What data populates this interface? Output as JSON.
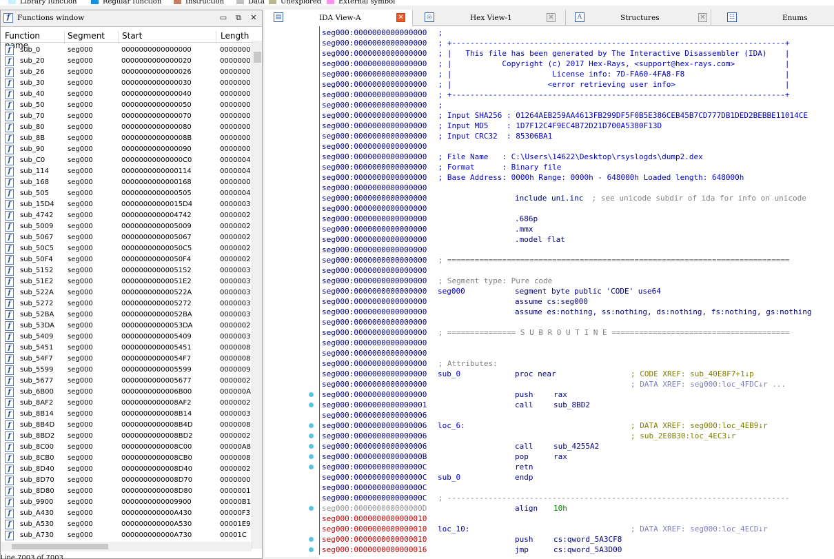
{
  "legend": [
    {
      "label": "Library function",
      "color": "#c8f0ff"
    },
    {
      "label": "Regular function",
      "color": "#1a8fe0"
    },
    {
      "label": "Instruction",
      "color": "#c08060"
    },
    {
      "label": "Data",
      "color": "#c0c0c0"
    },
    {
      "label": "Unexplored",
      "color": "#b8b890"
    },
    {
      "label": "External symbol",
      "color": "#ff90f0"
    }
  ],
  "functions_window": {
    "title": "Functions window",
    "columns": [
      "Function name",
      "Segment",
      "Start",
      "Length"
    ],
    "status": "Line 7003 of 7003",
    "rows": [
      [
        "sub_0",
        "seg000",
        "0000000000000000",
        "0000000"
      ],
      [
        "sub_20",
        "seg000",
        "0000000000000020",
        "0000000"
      ],
      [
        "sub_26",
        "seg000",
        "0000000000000026",
        "0000000"
      ],
      [
        "sub_30",
        "seg000",
        "0000000000000030",
        "0000000"
      ],
      [
        "sub_40",
        "seg000",
        "0000000000000040",
        "0000000"
      ],
      [
        "sub_50",
        "seg000",
        "0000000000000050",
        "0000000"
      ],
      [
        "sub_70",
        "seg000",
        "0000000000000070",
        "0000000"
      ],
      [
        "sub_80",
        "seg000",
        "0000000000000080",
        "0000000"
      ],
      [
        "sub_8B",
        "seg000",
        "000000000000008B",
        "0000000"
      ],
      [
        "sub_90",
        "seg000",
        "0000000000000090",
        "0000000"
      ],
      [
        "sub_C0",
        "seg000",
        "00000000000000C0",
        "0000004"
      ],
      [
        "sub_114",
        "seg000",
        "0000000000000114",
        "0000004"
      ],
      [
        "sub_168",
        "seg000",
        "0000000000000168",
        "0000000"
      ],
      [
        "sub_505",
        "seg000",
        "0000000000000505",
        "0000004"
      ],
      [
        "sub_15D4",
        "seg000",
        "00000000000015D4",
        "0000003"
      ],
      [
        "sub_4742",
        "seg000",
        "0000000000004742",
        "0000002"
      ],
      [
        "sub_5009",
        "seg000",
        "0000000000005009",
        "0000002"
      ],
      [
        "sub_5067",
        "seg000",
        "0000000000005067",
        "0000002"
      ],
      [
        "sub_50C5",
        "seg000",
        "00000000000050C5",
        "0000002"
      ],
      [
        "sub_50F4",
        "seg000",
        "00000000000050F4",
        "0000002"
      ],
      [
        "sub_5152",
        "seg000",
        "0000000000005152",
        "0000003"
      ],
      [
        "sub_51E2",
        "seg000",
        "00000000000051E2",
        "0000003"
      ],
      [
        "sub_522A",
        "seg000",
        "000000000000522A",
        "0000003"
      ],
      [
        "sub_5272",
        "seg000",
        "0000000000005272",
        "0000003"
      ],
      [
        "sub_52BA",
        "seg000",
        "00000000000052BA",
        "0000003"
      ],
      [
        "sub_53DA",
        "seg000",
        "00000000000053DA",
        "0000002"
      ],
      [
        "sub_5409",
        "seg000",
        "0000000000005409",
        "0000003"
      ],
      [
        "sub_5451",
        "seg000",
        "0000000000005451",
        "0000008"
      ],
      [
        "sub_54F7",
        "seg000",
        "00000000000054F7",
        "0000008"
      ],
      [
        "sub_5599",
        "seg000",
        "0000000000005599",
        "0000009"
      ],
      [
        "sub_5677",
        "seg000",
        "0000000000005677",
        "0000002"
      ],
      [
        "sub_6B00",
        "seg000",
        "0000000000006B00",
        "000000A"
      ],
      [
        "sub_8AF2",
        "seg000",
        "0000000000008AF2",
        "0000002"
      ],
      [
        "sub_8B14",
        "seg000",
        "0000000000008B14",
        "0000003"
      ],
      [
        "sub_8B4D",
        "seg000",
        "0000000000008B4D",
        "0000008"
      ],
      [
        "sub_8BD2",
        "seg000",
        "0000000000008BD2",
        "0000002"
      ],
      [
        "sub_8C00",
        "seg000",
        "0000000000008C00",
        "00000A8"
      ],
      [
        "sub_8CB0",
        "seg000",
        "0000000000008CB0",
        "0000008"
      ],
      [
        "sub_8D40",
        "seg000",
        "0000000000008D40",
        "0000002"
      ],
      [
        "sub_8D70",
        "seg000",
        "0000000000008D70",
        "0000000"
      ],
      [
        "sub_8D80",
        "seg000",
        "0000000000008D80",
        "0000001"
      ],
      [
        "sub_9900",
        "seg000",
        "0000000000009900",
        "00000B1"
      ],
      [
        "sub_A430",
        "seg000",
        "000000000000A430",
        "00000F3"
      ],
      [
        "sub_A530",
        "seg000",
        "000000000000A530",
        "00001E9"
      ],
      [
        "sub_A730",
        "seg000",
        "000000000000A730",
        "00001C"
      ]
    ]
  },
  "tabs": [
    {
      "label": "IDA View-A",
      "icon": "ida-view-icon"
    },
    {
      "label": "Hex View-1",
      "icon": "hex-view-icon"
    },
    {
      "label": "Structures",
      "icon": "structures-icon"
    },
    {
      "label": "Enums",
      "icon": "enums-icon"
    }
  ],
  "disassembly": {
    "addr_prefix": "seg000:",
    "lines": [
      {
        "a": "0000000000000000",
        "t": "c",
        "s": " ;"
      },
      {
        "a": "0000000000000000",
        "t": "c",
        "s": " ; +-------------------------------------------------------------------------+"
      },
      {
        "a": "0000000000000000",
        "t": "c",
        "s": " ; |   This file has been generated by The Interactive Disassembler (IDA)    |"
      },
      {
        "a": "0000000000000000",
        "t": "c",
        "s": " ; |           Copyright (c) 2017 Hex-Rays, <support@hex-rays.com>           |"
      },
      {
        "a": "0000000000000000",
        "t": "c",
        "s": " ; |                      License info: 7D-FA60-4FA8-F8                      |"
      },
      {
        "a": "0000000000000000",
        "t": "c",
        "s": " ; |                     <error retrieving user info>                        |"
      },
      {
        "a": "0000000000000000",
        "t": "c",
        "s": " ; +-------------------------------------------------------------------------+"
      },
      {
        "a": "0000000000000000",
        "t": "c",
        "s": " ;"
      },
      {
        "a": "0000000000000000",
        "t": "c",
        "s": " ; Input SHA256 : 01264AEB259AA4613FB299DF5F0B5E386CEB45B7CD777DB1DED2BEBBE11014CE"
      },
      {
        "a": "0000000000000000",
        "t": "c",
        "s": " ; Input MD5    : 1D7F12C4F9EC4B72D21D700A5380F13D"
      },
      {
        "a": "0000000000000000",
        "t": "c",
        "s": " ; Input CRC32  : 85306BA1"
      },
      {
        "a": "0000000000000000",
        "t": "c",
        "s": ""
      },
      {
        "a": "0000000000000000",
        "t": "c",
        "s": " ; File Name   : C:\\Users\\14622\\Desktop\\rsyslogds\\dump2.dex"
      },
      {
        "a": "0000000000000000",
        "t": "c",
        "s": " ; Format      : Binary file"
      },
      {
        "a": "0000000000000000",
        "t": "c",
        "s": " ; Base Address: 0000h Range: 0000h - 648000h Loaded length: 648000h"
      },
      {
        "a": "0000000000000000",
        "t": "c",
        "s": ""
      },
      {
        "a": "0000000000000000",
        "t": "i",
        "mn": "include uni.inc",
        "cm": " ; see unicode subdir of ida for info on unicode",
        "cmx": 385
      },
      {
        "a": "0000000000000000",
        "t": "c",
        "s": ""
      },
      {
        "a": "0000000000000000",
        "t": "i",
        "mn": ".686p"
      },
      {
        "a": "0000000000000000",
        "t": "i",
        "mn": ".mmx"
      },
      {
        "a": "0000000000000000",
        "t": "i",
        "mn": ".model flat"
      },
      {
        "a": "0000000000000000",
        "t": "c",
        "s": ""
      },
      {
        "a": "0000000000000000",
        "t": "g",
        "s": " ; ==========================================================================="
      },
      {
        "a": "0000000000000000",
        "t": "c",
        "s": ""
      },
      {
        "a": "0000000000000000",
        "t": "g",
        "s": " ; Segment type: Pure code"
      },
      {
        "a": "0000000000000000",
        "t": "i",
        "lbl": "seg000",
        "mn": "segment byte public 'CODE' use64"
      },
      {
        "a": "0000000000000000",
        "t": "i",
        "mn": "assume cs:seg000"
      },
      {
        "a": "0000000000000000",
        "t": "i",
        "mn": "assume es:nothing, ss:nothing, ds:nothing, fs:nothing, gs:nothing"
      },
      {
        "a": "0000000000000000",
        "t": "c",
        "s": ""
      },
      {
        "a": "0000000000000000",
        "t": "g",
        "s": " ; =============== S U B R O U T I N E ======================================="
      },
      {
        "a": "0000000000000000",
        "t": "c",
        "s": ""
      },
      {
        "a": "0000000000000000",
        "t": "c",
        "s": ""
      },
      {
        "a": "0000000000000000",
        "t": "g",
        "s": " ; Attributes:"
      },
      {
        "a": "0000000000000000",
        "t": "i",
        "lbl": "sub_0",
        "mn": "proc near",
        "xr": "; CODE XREF: sub_40E8F7+1↓p"
      },
      {
        "a": "0000000000000000",
        "t": "i",
        "xrd": "; DATA XREF: seg000:loc_4FDC↓r ..."
      },
      {
        "a": "0000000000000000",
        "t": "i",
        "mn": "push",
        "op": "rax",
        "dot": true
      },
      {
        "a": "0000000000000001",
        "t": "i",
        "mn": "call",
        "op": "sub_8BD2",
        "dot": true
      },
      {
        "a": "0000000000000006",
        "t": "c",
        "s": ""
      },
      {
        "a": "0000000000000006",
        "t": "i",
        "lbl": "loc_6:",
        "xr": "; DATA XREF: seg000:loc_4EB9↓r",
        "dot": true
      },
      {
        "a": "0000000000000006",
        "t": "i",
        "xr": "; sub_2E0B30:loc_4EC3↓r",
        "dot": true
      },
      {
        "a": "0000000000000006",
        "t": "i",
        "mn": "call",
        "op": "sub_4255A2",
        "dot": true
      },
      {
        "a": "000000000000000B",
        "t": "i",
        "mn": "pop",
        "op": "rax",
        "dot": true
      },
      {
        "a": "000000000000000C",
        "t": "i",
        "mn": "retn",
        "dot": true
      },
      {
        "a": "000000000000000C",
        "t": "i",
        "lbl": "sub_0",
        "mn": "endp"
      },
      {
        "a": "000000000000000C",
        "t": "c",
        "s": ""
      },
      {
        "a": "000000000000000C",
        "t": "g",
        "s": " ; ---------------------------------------------------------------------------"
      },
      {
        "a": "000000000000000D",
        "t": "a",
        "mn": "align",
        "op": "10h",
        "gray": true,
        "dot": true
      },
      {
        "a": "0000000000000010",
        "t": "c",
        "s": "",
        "red": true
      },
      {
        "a": "0000000000000010",
        "t": "i",
        "lbl": "loc_10:",
        "xrd": "; DATA XREF: seg000:loc_4ECD↓r",
        "red": true
      },
      {
        "a": "0000000000000010",
        "t": "i",
        "mn": "push",
        "op": "cs:qword_5A3CF8",
        "red": true,
        "dot": true
      },
      {
        "a": "0000000000000016",
        "t": "i",
        "mn": "jmp",
        "op": "cs:qword_5A3D00",
        "red": true,
        "dot": true
      }
    ]
  }
}
